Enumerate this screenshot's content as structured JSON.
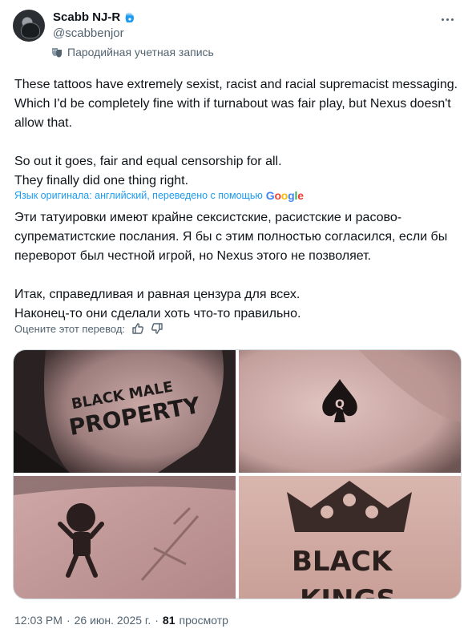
{
  "author": {
    "display_name": "Scabb NJ-R",
    "handle": "@scabbenjor",
    "account_label": "Пародийная учетная запись"
  },
  "tweet": {
    "original_lines": [
      "These tattoos have extremely sexist, racist and racial supremacist messaging. Which I'd be completely fine with if turnabout was fair play, but Nexus doesn't allow that.",
      "So out it goes, fair and equal censorship for all.",
      "They finally did one thing right."
    ],
    "translation_note": "Язык оригинала: английский, переведено с помощью",
    "translation_provider": "Google",
    "translated_lines": [
      "Эти татуировки имеют крайне сексистские, расистские и расово-супрематистские послания. Я бы с этим полностью согласился, если бы переворот был честной игрой, но Nexus этого не позволяет.",
      "Итак, справедливая и равная цензура для всех.",
      "Наконец-то они сделали хоть что-то правильно."
    ],
    "rate_translation_label": "Оцените этот перевод:"
  },
  "media": {
    "tile_1_text": [
      "BLACK MALE",
      "PROPERTY"
    ],
    "tile_4_text": [
      "BLACK",
      "KINGS"
    ]
  },
  "meta": {
    "time": "12:03 PM",
    "date": "26 июн. 2025 г.",
    "views_count": "81",
    "views_label": "просмотр"
  },
  "colors": {
    "accent_blue": "#1d9bf0",
    "secondary_text": "#536471",
    "primary_text": "#0f1419"
  }
}
